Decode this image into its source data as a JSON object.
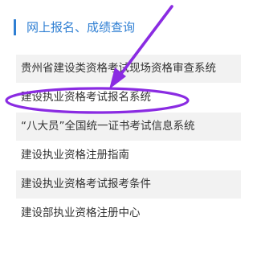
{
  "section": {
    "title": "网上报名、成绩查询",
    "accent_color": "#2f7fd3"
  },
  "menu": {
    "items": [
      {
        "label": "贵州省建设类资格考试现场资格审查系统",
        "shaded": true
      },
      {
        "label": "建设执业资格考试报名系统",
        "shaded": false,
        "highlighted": true
      },
      {
        "label": "“八大员”全国统一证书考试信息系统",
        "shaded": true
      },
      {
        "label": "建设执业资格注册指南",
        "shaded": false
      },
      {
        "label": "建设执业资格考试报考条件",
        "shaded": true
      },
      {
        "label": "建设部执业资格注册中心",
        "shaded": false
      }
    ]
  },
  "annotation": {
    "color": "#8a2be2"
  }
}
